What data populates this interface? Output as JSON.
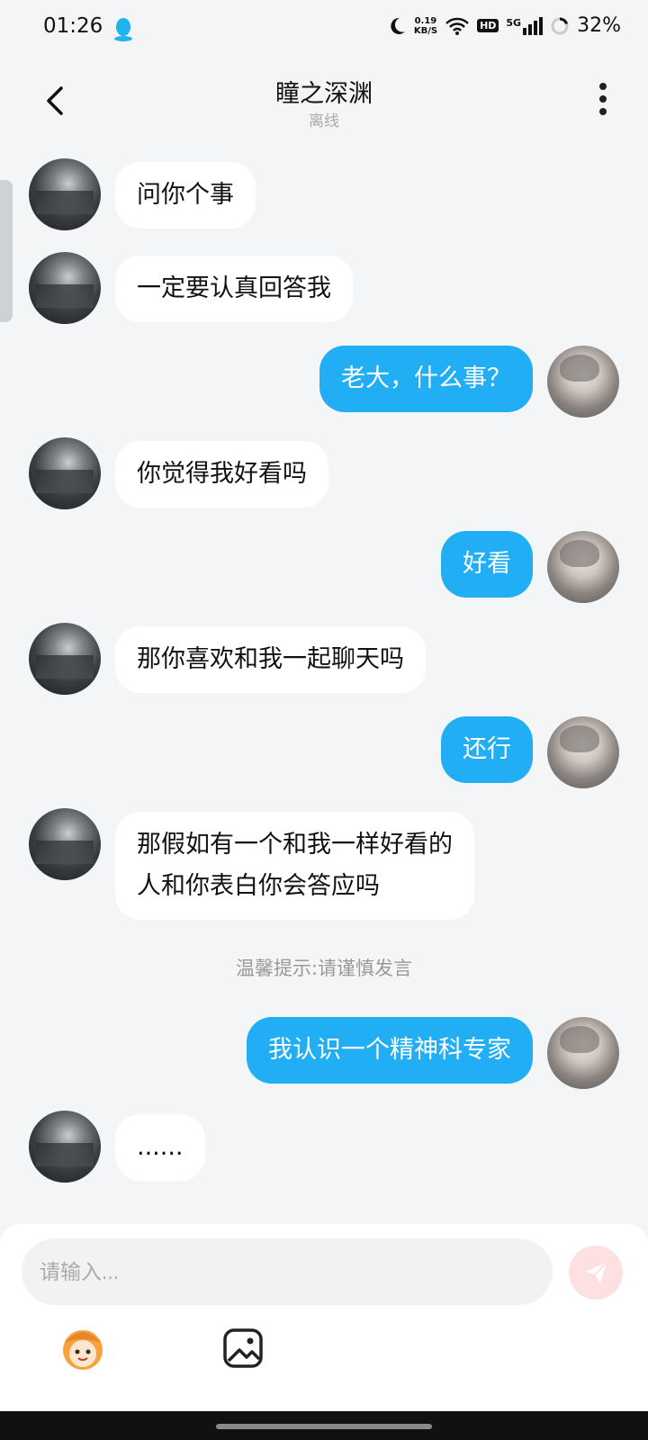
{
  "status": {
    "time": "01:26",
    "speed_value": "0.19",
    "speed_unit": "KB/S",
    "hd": "HD",
    "network": "5G",
    "battery": "32%"
  },
  "header": {
    "title": "瞳之深渊",
    "subtitle": "离线"
  },
  "messages": [
    {
      "from": "them",
      "text": "问你个事"
    },
    {
      "from": "them",
      "text": "一定要认真回答我"
    },
    {
      "from": "me",
      "text": "老大，什么事？"
    },
    {
      "from": "them",
      "text": "你觉得我好看吗"
    },
    {
      "from": "me",
      "text": "好看"
    },
    {
      "from": "them",
      "text": "那你喜欢和我一起聊天吗"
    },
    {
      "from": "me",
      "text": "还行"
    },
    {
      "from": "them",
      "text_line1": "那假如有一个和我一样好看的",
      "text_line2": "人和你表白你会答应吗"
    },
    {
      "from": "me",
      "text": "我认识一个精神科专家"
    },
    {
      "from": "them",
      "text": "......"
    }
  ],
  "tip": "温馨提示:请谨慎发言",
  "input": {
    "placeholder": "请输入..."
  },
  "colors": {
    "accent": "#22aef4",
    "background": "#f3f5f7",
    "send_disabled": "#fde1e1"
  }
}
